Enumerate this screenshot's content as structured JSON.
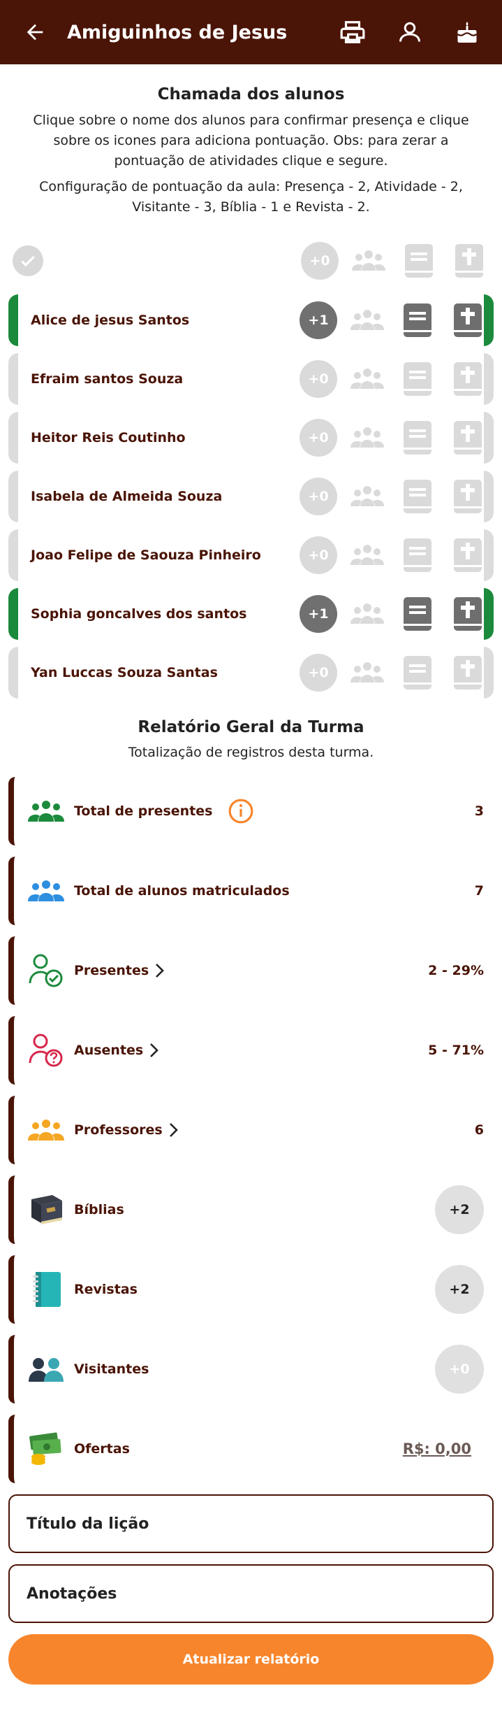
{
  "appbar": {
    "title": "Amiguinhos de Jesus"
  },
  "attendance": {
    "title": "Chamada dos alunos",
    "instructions": "Clique sobre o nome dos alunos para confirmar presença e clique sobre os icones para adiciona pontuação. Obs: para zerar a pontuação de atividades clique e segure.",
    "config": "Configuração de pontuação da aula: Presença - 2, Atividade - 2, Visitante - 3, Bíblia - 1 e Revista - 2.",
    "header_points": "+0",
    "students": [
      {
        "name": "Alice de jesus Santos",
        "points": "+1",
        "present": true
      },
      {
        "name": "Efraim  santos Souza",
        "points": "+0",
        "present": false
      },
      {
        "name": "Heitor Reis Coutinho",
        "points": "+0",
        "present": false
      },
      {
        "name": "Isabela de Almeida Souza",
        "points": "+0",
        "present": false
      },
      {
        "name": "Joao Felipe de Saouza Pinheiro",
        "points": "+0",
        "present": false
      },
      {
        "name": "Sophia goncalves dos santos",
        "points": "+1",
        "present": true
      },
      {
        "name": "Yan Luccas Souza  Santas",
        "points": "+0",
        "present": false
      }
    ]
  },
  "report": {
    "title": "Relatório Geral da Turma",
    "subtitle": "Totalização de registros desta turma.",
    "total_presentes": {
      "label": "Total de presentes",
      "value": "3"
    },
    "total_matriculados": {
      "label": "Total de alunos matriculados",
      "value": "7"
    },
    "presentes": {
      "label": "Presentes",
      "value": "2 - 29%"
    },
    "ausentes": {
      "label": "Ausentes",
      "value": "5 - 71%"
    },
    "professores": {
      "label": "Professores",
      "value": "6"
    },
    "biblias": {
      "label": "Bíblias",
      "value": "+2"
    },
    "revistas": {
      "label": "Revistas",
      "value": "+2"
    },
    "visitantes": {
      "label": "Visitantes",
      "value": "+0"
    },
    "ofertas": {
      "label": "Ofertas",
      "value": "R$: 0,00"
    }
  },
  "form": {
    "lesson_title": "Título da lição",
    "notes": "Anotações",
    "submit": "Atualizar relatório"
  },
  "colors": {
    "brand": "#4a1406",
    "present": "#1c8a3c",
    "accent": "#f7852c"
  }
}
